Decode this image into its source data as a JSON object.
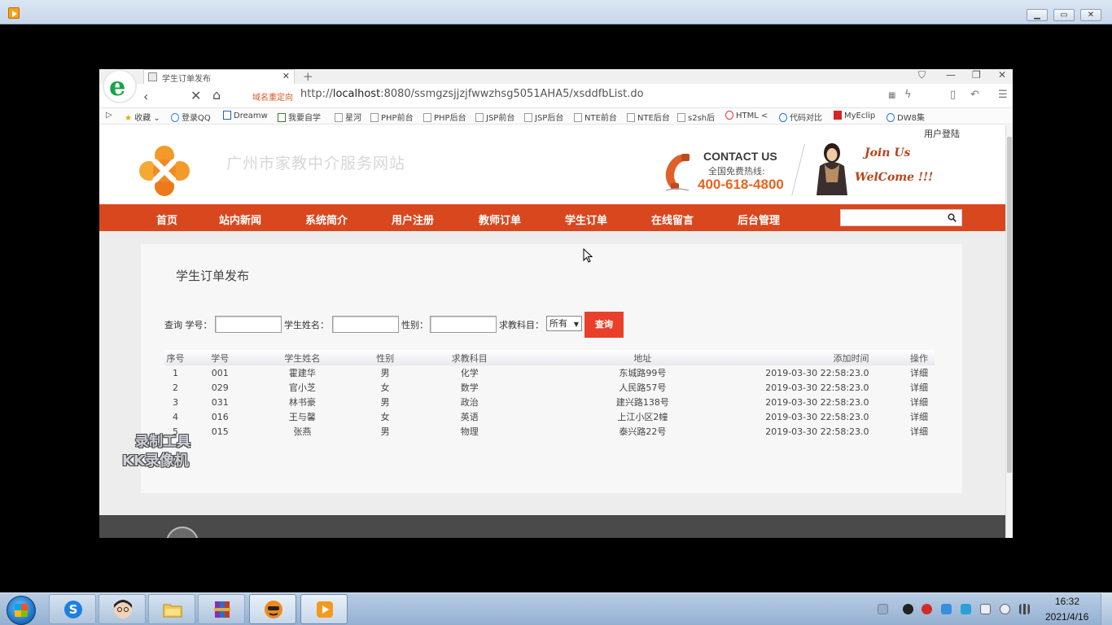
{
  "browser": {
    "tab_title": "学生订单发布",
    "redirect_label": "域名重定向",
    "url_prefix": "http://",
    "url_host": "localhost",
    "url_rest": ":8080/ssmgzsjjzjfwwzhsg5051AHA5/xsddfbList.do"
  },
  "bookmarks": [
    "收藏",
    "登录QQ",
    "Dreamw",
    "我要自学",
    "星河",
    "PHP前台",
    "PHP后台",
    "JSP前台",
    "JSP后台",
    "NTE前台",
    "NTE后台",
    "s2sh后",
    "HTML <",
    "代码对比",
    "MyEclip",
    "DW8集"
  ],
  "site": {
    "login_link": "用户登陆",
    "title": "广州市家教中介服务网站",
    "contact_title": "CONTACT US",
    "contact_sub": "全国免费热线:",
    "contact_phone": "400-618-4800",
    "join_line1": "Join Us",
    "join_line2": "WelCome !!!"
  },
  "nav": [
    "首页",
    "站内新闻",
    "系统简介",
    "用户注册",
    "教师订单",
    "学生订单",
    "在线留言",
    "后台管理"
  ],
  "page": {
    "heading": "学生订单发布",
    "query_prefix": "查询",
    "label_student_no": "学号：",
    "label_student_name": "学生姓名：",
    "label_gender": "性别：",
    "label_subject": "求教科目：",
    "subject_selected": "所有",
    "search_button": "查询"
  },
  "table": {
    "headers": [
      "序号",
      "学号",
      "学生姓名",
      "性别",
      "求教科目",
      "地址",
      "添加时间",
      "操作"
    ],
    "rows": [
      [
        "1",
        "001",
        "霍建华",
        "男",
        "化学",
        "东城路99号",
        "2019-03-30 22:58:23.0",
        "详细"
      ],
      [
        "2",
        "029",
        "官小芝",
        "女",
        "数学",
        "人民路57号",
        "2019-03-30 22:58:23.0",
        "详细"
      ],
      [
        "3",
        "031",
        "林书豪",
        "男",
        "政治",
        "建兴路138号",
        "2019-03-30 22:58:23.0",
        "详细"
      ],
      [
        "4",
        "016",
        "王与馨",
        "女",
        "英语",
        "上江小区2幢",
        "2019-03-30 22:58:23.0",
        "详细"
      ],
      [
        "5",
        "015",
        "张燕",
        "男",
        "物理",
        "泰兴路22号",
        "2019-03-30 22:58:23.0",
        "详细"
      ]
    ]
  },
  "watermark": {
    "line1": "录制工具",
    "line2": "KK录像机"
  },
  "taskbar": {
    "time": "16:32",
    "date": "2021/4/16"
  },
  "colors": {
    "nav_bg": "#d8471e",
    "accent_orange": "#e5651f",
    "search_button": "#e8402a"
  }
}
